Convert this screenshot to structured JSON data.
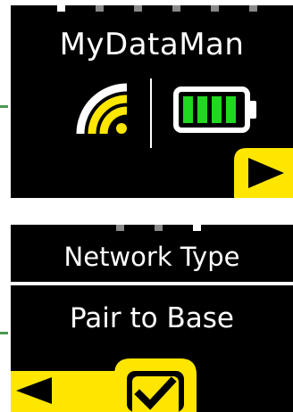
{
  "colors": {
    "accent_yellow": "#ffe600",
    "battery_green": "#1fd81f",
    "pointer_green": "#4a9a54",
    "dot_grey": "#8a8a8a",
    "background": "#000000",
    "text": "#ffffff"
  },
  "screen1": {
    "title": "MyDataMan",
    "signal_icon": "wifi-signal-icon",
    "battery_icon": "battery-icon",
    "battery_level_bars": 4,
    "battery_level_total": 4,
    "next_icon": "play-right-icon",
    "page_indicator": {
      "count": 6,
      "active": 0
    }
  },
  "screen2": {
    "menu_title": "Network Type",
    "selected_item": "Pair to Base",
    "back_icon": "arrow-left-icon",
    "confirm_icon": "checkmark-icon",
    "page_indicator": {
      "count": 3,
      "active": 2
    }
  }
}
